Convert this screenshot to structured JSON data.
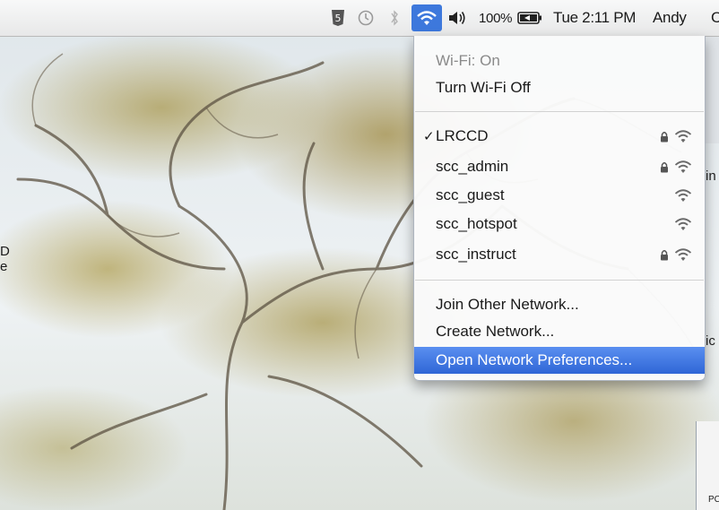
{
  "menubar": {
    "battery_percent": "100%",
    "clock": "Tue 2:11 PM",
    "user": "Andy",
    "cut_off_right": "C",
    "icons": [
      "html5-shield-icon",
      "time-machine-icon",
      "bluetooth-icon",
      "wifi-icon",
      "volume-icon",
      "battery-icon"
    ],
    "wifi_highlight_color": "#3d78dc"
  },
  "wifi_menu": {
    "status": "Wi-Fi: On",
    "toggle": "Turn Wi-Fi Off",
    "networks": [
      {
        "name": "LRCCD",
        "selected": true,
        "locked": true
      },
      {
        "name": "scc_admin",
        "selected": false,
        "locked": true
      },
      {
        "name": "scc_guest",
        "selected": false,
        "locked": false
      },
      {
        "name": "scc_hotspot",
        "selected": false,
        "locked": false
      },
      {
        "name": "scc_instruct",
        "selected": false,
        "locked": true
      }
    ],
    "checkmark": "✓",
    "join_other": "Join Other Network...",
    "create": "Create Network...",
    "open_prefs": "Open Network Preferences...",
    "highlight_color": "#2f66d6"
  },
  "background": {
    "left_edge_text_1": "D",
    "left_edge_text_2": "e",
    "right_edge_text_1": "in",
    "right_edge_text_2": "ic",
    "right_edge_text_3": "PC"
  }
}
